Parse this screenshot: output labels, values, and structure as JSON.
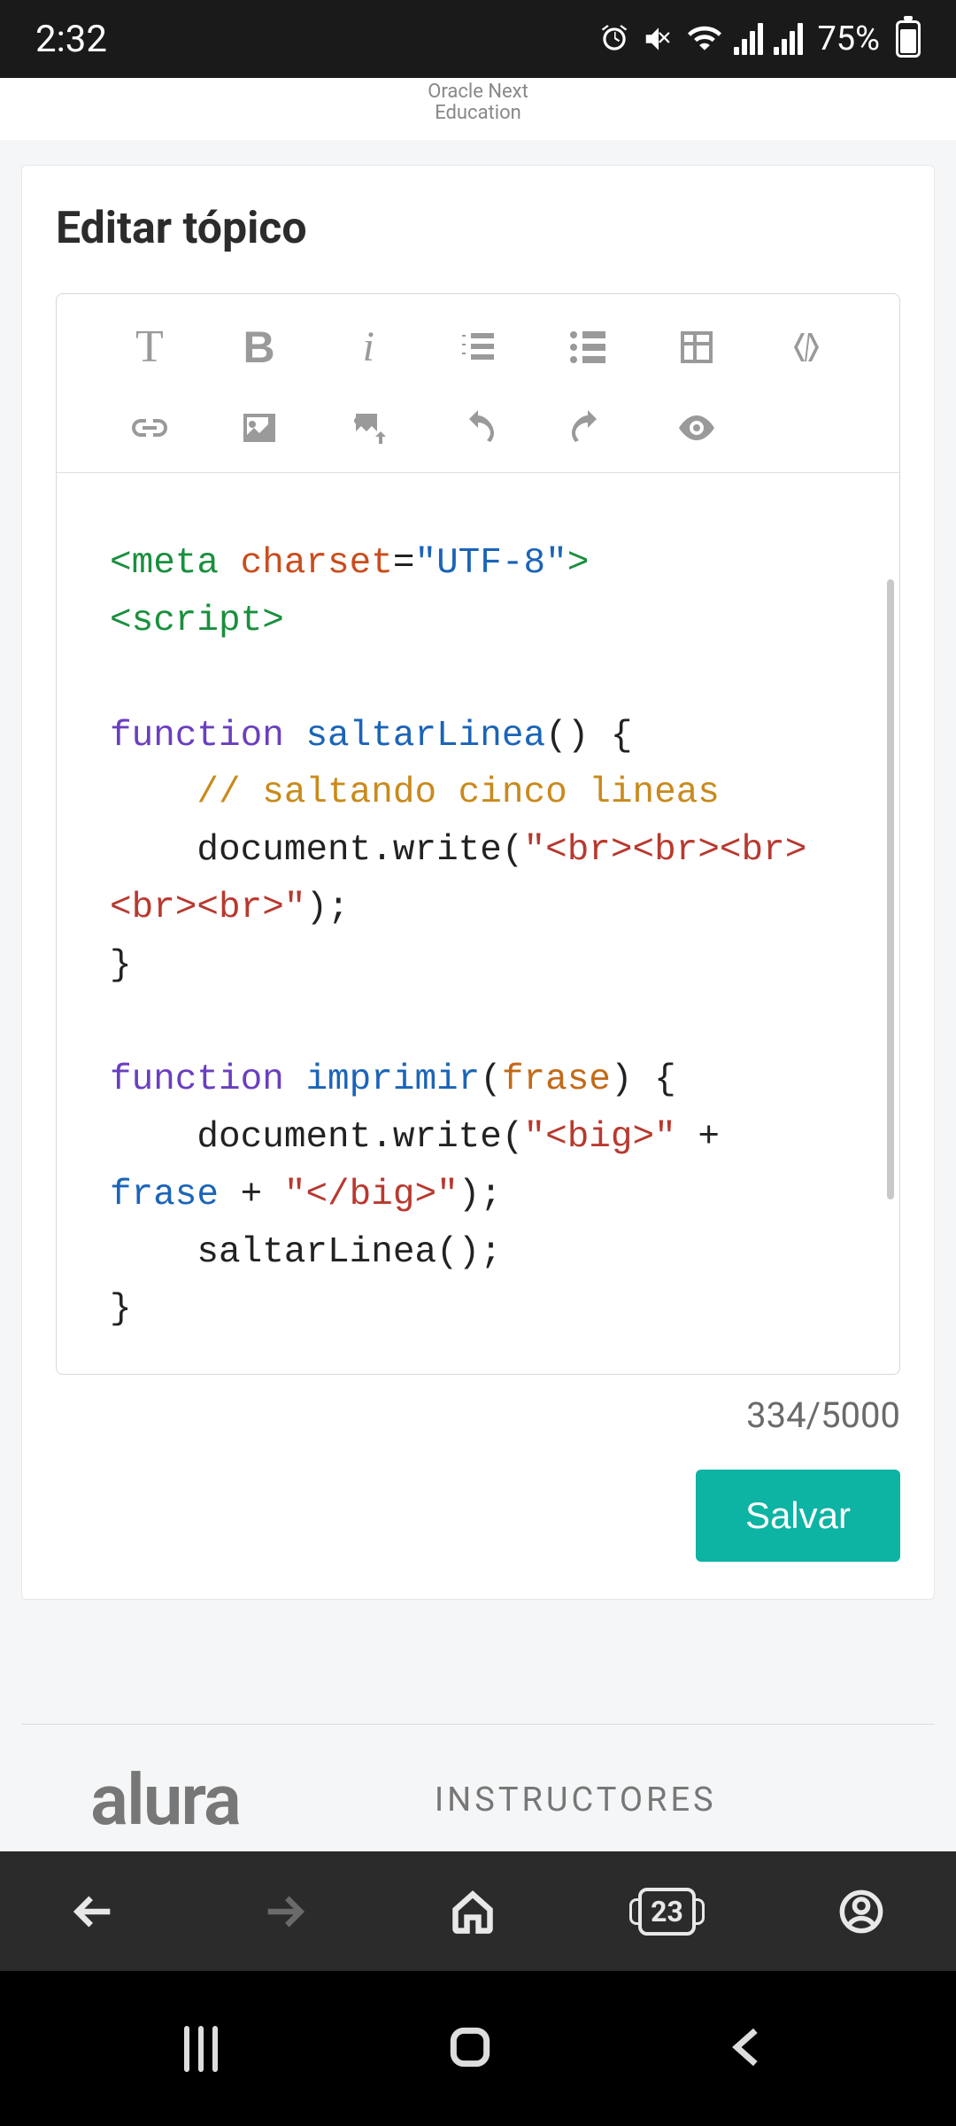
{
  "status": {
    "time": "2:32",
    "battery": "75%"
  },
  "header": {
    "line1": "Oracle Next",
    "line2": "Education"
  },
  "card": {
    "title": "Editar tópico",
    "counter": "334/5000",
    "save_label": "Salvar"
  },
  "code": {
    "l1": {
      "open": "<meta ",
      "attr": "charset",
      "eq": "=",
      "val": "\"UTF-8\"",
      "close": ">"
    },
    "l2": "<script>",
    "l3": {
      "kw": "function ",
      "fn": "saltarLinea",
      "rest": "() {"
    },
    "l4": "    // saltando cinco lineas",
    "l5": {
      "a": "    document.write(",
      "q1": "\"",
      "tags": "<br><br><br><br><br>",
      "q2": "\"",
      "b": ");"
    },
    "l6": "}",
    "l7": {
      "kw": "function ",
      "fn": "imprimir",
      "lp": "(",
      "param": "frase",
      "rp": ") {"
    },
    "l8": {
      "a": "    document.write(",
      "q1": "\"",
      "tag1": "<big>",
      "q2": "\"",
      "plus1": " + ",
      "var": "frase",
      "plus2": " + ",
      "q3": "\"",
      "tag2": "</big>",
      "q4": "\"",
      "b": ");"
    },
    "l9": "    saltarLinea();",
    "l10": "}"
  },
  "footer": {
    "logo": "alura",
    "link": "INSTRUCTORES"
  },
  "browser": {
    "tabs": "23"
  }
}
